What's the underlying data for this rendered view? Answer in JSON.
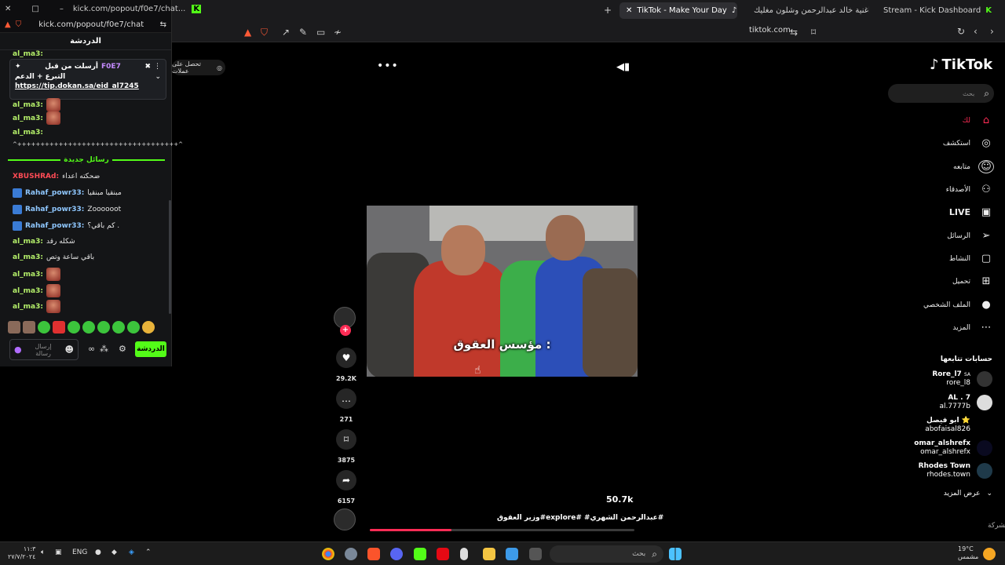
{
  "browser": {
    "tabs": [
      {
        "label": "TikTok - Make Your Day",
        "active": true
      },
      {
        "label": "اغنية خالد عبدالرحمن وشلون مغليك - ...",
        "active": false
      },
      {
        "label": "Stream - Kick Dashboard",
        "active": false
      }
    ],
    "url": "tiktok.com"
  },
  "kick": {
    "window_url": "kick.com/popout/f0e7/chat...",
    "window_url_full": "kick.com/popout/f0e7/chat",
    "header": "الدردشة",
    "pinned": {
      "sent_by_label": "أرسلت من قبل",
      "sender": "F0E7",
      "title": "التبرع + الدعم",
      "link": "https://tip.dokan.sa/eid_al7245"
    },
    "messages_top": [
      {
        "user": "al_ma3:",
        "emote": true
      },
      {
        "user": "al_ma3:",
        "emote": true
      },
      {
        "user": "al_ma3:",
        "text": "^+++++++++++++++++++++++++++++++++++^"
      }
    ],
    "new_messages_label": "رسائل جديدة",
    "messages_bottom": [
      {
        "user": "XBUSHRAd:",
        "text": "ضحكته اعداء",
        "style": "red"
      },
      {
        "user": "Rahaf_powr33:",
        "text": "مبنقيا مبنقيا",
        "badge": true
      },
      {
        "user": "Rahaf_powr33:",
        "text": "Zoooooot",
        "badge": true
      },
      {
        "user": "Rahaf_powr33:",
        "text": "كم باقي؟ .",
        "badge": true
      },
      {
        "user": "al_ma3:",
        "text": "شكله رقد"
      },
      {
        "user": "al_ma3:",
        "text": "باقي ساعة وتص"
      },
      {
        "user": "al_ma3:",
        "emote": true
      },
      {
        "user": "al_ma3:",
        "emote": true
      },
      {
        "user": "al_ma3:",
        "emote": true
      }
    ],
    "input_placeholder": "إرسال رسالة",
    "send_label": "الدردشة"
  },
  "tiktok": {
    "notif_chip": "تحصل على عملات",
    "subtitle": "مؤسس العقوق :",
    "likes": "29.2K",
    "comments": "271",
    "saves": "3875",
    "shares": "6157",
    "views": "50.7k",
    "caption": "وزير العقوق#explore# #عبدالرحمن الشهري#",
    "progress": 0.31,
    "logo": "TikTok",
    "search_placeholder": "بحث",
    "nav": [
      {
        "label": "لك",
        "icon": "home-icon",
        "active": true
      },
      {
        "label": "استكشف",
        "icon": "compass-icon"
      },
      {
        "label": "متابعه",
        "icon": "following-icon"
      },
      {
        "label": "الأصدقاء",
        "icon": "friends-icon"
      },
      {
        "label": "LIVE",
        "icon": "live-icon"
      },
      {
        "label": "الرسائل",
        "icon": "messages-icon"
      },
      {
        "label": "النشاط",
        "icon": "activity-icon"
      },
      {
        "label": "تحميل",
        "icon": "upload-icon"
      },
      {
        "label": "الملف الشخصي",
        "icon": "profile-icon"
      },
      {
        "label": "المزيد",
        "icon": "more-icon"
      }
    ],
    "following_title": "حسابات تتابعها",
    "following": [
      {
        "name": "Rore_l7",
        "flag": "SA",
        "handle": "rore_l8"
      },
      {
        "name": "AL . 7",
        "handle": "al.7777b"
      },
      {
        "name": "ابو فيصل ⭐",
        "handle": "abofaisal826"
      },
      {
        "name": "omar_alshrefx",
        "handle": "omar_alshrefx"
      },
      {
        "name": "Rhodes Town",
        "handle": "rhodes.town"
      }
    ],
    "see_more": "عرض المزيد",
    "company": "الشركة"
  },
  "taskbar": {
    "search_placeholder": "بحث",
    "lang": "ENG",
    "clock_time": "١١:٣",
    "clock_date": "٢٧/٧/٢٠٢٤",
    "weather_temp": "19°C",
    "weather_desc": "مشمس"
  }
}
